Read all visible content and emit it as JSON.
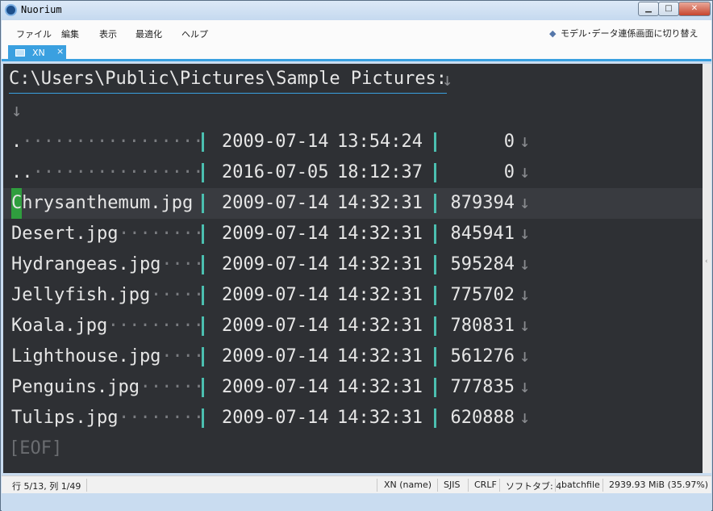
{
  "window": {
    "title": "Nuorium",
    "minimize_glyph": "▁",
    "maximize_glyph": "□",
    "close_glyph": "✕"
  },
  "menu": {
    "file": "ファイル",
    "edit": "編集",
    "view": "表示",
    "optimize": "最適化",
    "help": "ヘルプ",
    "mode_switch": "モデル･データ連係画面に切り替え"
  },
  "tab": {
    "label": "XN",
    "close": "×"
  },
  "editor": {
    "path": "C:\\Users\\Public\\Pictures\\Sample Pictures:",
    "line_feed": "↓",
    "eof": "[EOF]",
    "cursor_char": "C",
    "rows": [
      {
        "name": ".",
        "fill": "·················",
        "date": "2009-07-14",
        "time": "13:54:24",
        "size": "0"
      },
      {
        "name": "..",
        "fill": "················",
        "date": "2016-07-05",
        "time": "18:12:37",
        "size": "0"
      },
      {
        "name": "hrysanthemum.jpg",
        "fill": "",
        "date": "2009-07-14",
        "time": "14:32:31",
        "size": "879394"
      },
      {
        "name": "Desert.jpg",
        "fill": "········",
        "date": "2009-07-14",
        "time": "14:32:31",
        "size": "845941"
      },
      {
        "name": "Hydrangeas.jpg",
        "fill": "····",
        "date": "2009-07-14",
        "time": "14:32:31",
        "size": "595284"
      },
      {
        "name": "Jellyfish.jpg",
        "fill": "·····",
        "date": "2009-07-14",
        "time": "14:32:31",
        "size": "775702"
      },
      {
        "name": "Koala.jpg",
        "fill": "·········",
        "date": "2009-07-14",
        "time": "14:32:31",
        "size": "780831"
      },
      {
        "name": "Lighthouse.jpg",
        "fill": "····",
        "date": "2009-07-14",
        "time": "14:32:31",
        "size": "561276"
      },
      {
        "name": "Penguins.jpg",
        "fill": "······",
        "date": "2009-07-14",
        "time": "14:32:31",
        "size": "777835"
      },
      {
        "name": "Tulips.jpg",
        "fill": "········",
        "date": "2009-07-14",
        "time": "14:32:31",
        "size": "620888"
      }
    ]
  },
  "status": {
    "position": "行 5/13, 列 1/49",
    "mode": "XN (name)",
    "encoding": "SJIS",
    "eol": "CRLF",
    "tab": "ソフトタブ: 4",
    "syntax": "batchfile",
    "memory": "2939.93 MiB (35.97%)"
  }
}
